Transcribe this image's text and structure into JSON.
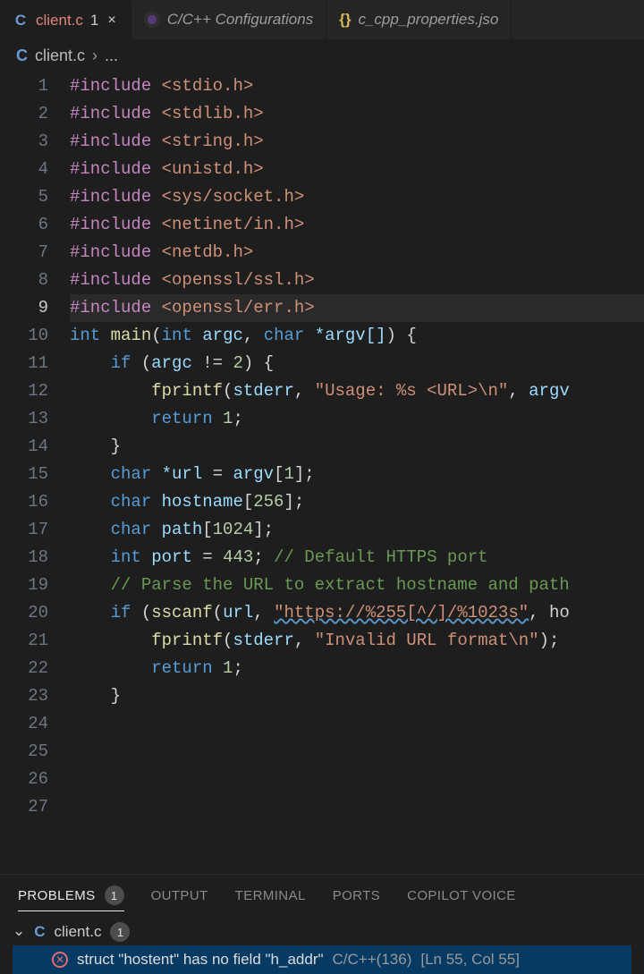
{
  "tabs": [
    {
      "icon": "C",
      "label": "client.c",
      "modifiedCount": "1",
      "active": true
    },
    {
      "iconType": "cfg",
      "label": "C/C++ Configurations"
    },
    {
      "iconType": "json",
      "iconText": "{}",
      "label": "c_cpp_properties.jso"
    }
  ],
  "breadcrumb": {
    "icon": "C",
    "file": "client.c",
    "sep": "›",
    "more": "..."
  },
  "lineCount": 27,
  "currentLine": 9,
  "code": {
    "includes": [
      "<stdio.h>",
      "<stdlib.h>",
      "<string.h>",
      "<unistd.h>",
      "<sys/socket.h>",
      "<netinet/in.h>",
      "<netdb.h>",
      "<openssl/ssl.h>",
      "<openssl/err.h>"
    ],
    "sig": {
      "ret": "int",
      "name": "main",
      "p1type": "int",
      "p1name": "argc",
      "p2type": "char",
      "p2name": "*argv[]"
    },
    "ifArgc": {
      "kw": "if",
      "var": "argc",
      "op": "!=",
      "val": "2"
    },
    "fprintf1": {
      "fn": "fprintf",
      "stream": "stderr",
      "fmt": "\"Usage: %s <URL>\\n\"",
      "arg": "argv"
    },
    "return1": {
      "kw": "return",
      "val": "1"
    },
    "decls": {
      "url": {
        "type": "char",
        "name": "*url",
        "rhs": "argv",
        "idx": "1"
      },
      "host": {
        "type": "char",
        "name": "hostname",
        "size": "256"
      },
      "path": {
        "type": "char",
        "name": "path",
        "size": "1024"
      },
      "port": {
        "type": "int",
        "name": "port",
        "val": "443",
        "cmt": "// Default HTTPS port"
      }
    },
    "cmtParse": "// Parse the URL to extract hostname and path",
    "sscanf": {
      "kw": "if",
      "fn": "sscanf",
      "arg1": "url",
      "fmt": "\"https://%255[^/]/%1023s\"",
      "tail": ", ho"
    },
    "fprintf2": {
      "fn": "fprintf",
      "stream": "stderr",
      "fmt": "\"Invalid URL format\\n\""
    },
    "return2": {
      "kw": "return",
      "val": "1"
    }
  },
  "panel": {
    "tabs": [
      {
        "label": "PROBLEMS",
        "count": "1",
        "active": true
      },
      {
        "label": "OUTPUT"
      },
      {
        "label": "TERMINAL"
      },
      {
        "label": "PORTS"
      },
      {
        "label": "COPILOT VOICE"
      }
    ],
    "file": {
      "icon": "C",
      "name": "client.c",
      "count": "1"
    },
    "item": {
      "message": "struct \"hostent\" has no field \"h_addr\"",
      "source": "C/C++(136)",
      "location": "[Ln 55, Col 55]"
    }
  }
}
